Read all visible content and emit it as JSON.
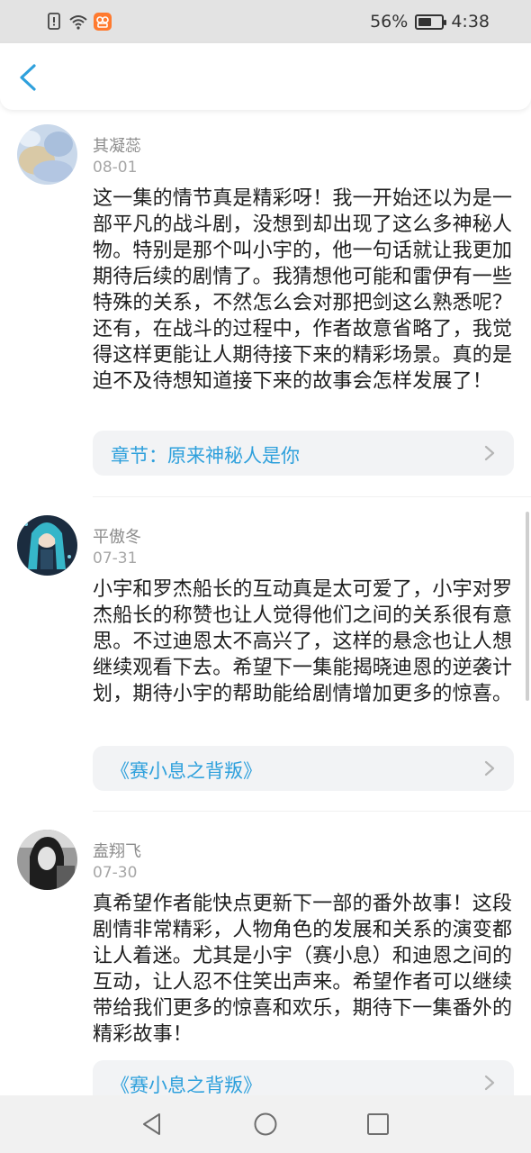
{
  "status_bar": {
    "battery_percent": "56%",
    "battery_level": 0.56,
    "time": "4:38",
    "icons": [
      "alert-icon",
      "wifi-icon",
      "app-notification-icon",
      "battery-charging-icon"
    ]
  },
  "header": {
    "back_icon": "chevron-left-icon",
    "accent_color": "#2ea0dc"
  },
  "comments": [
    {
      "author": "其凝蕊",
      "date": "08-01",
      "text": "这一集的情节真是精彩呀！我一开始还以为是一部平凡的战斗剧，没想到却出现了这么多神秘人物。特别是那个叫小宇的，他一句话就让我更加期待后续的剧情了。我猜想他可能和雷伊有一些特殊的关系，不然怎么会对那把剑这么熟悉呢？还有，在战斗的过程中，作者故意省略了，我觉得这样更能让人期待接下来的精彩场景。真的是迫不及待想知道接下来的故事会怎样发展了！",
      "chapter": "章节：原来神秘人是你"
    },
    {
      "author": "平傲冬",
      "date": "07-31",
      "text": "小宇和罗杰船长的互动真是太可爱了，小宇对罗杰船长的称赞也让人觉得他们之间的关系很有意思。不过迪恩太不高兴了，这样的悬念也让人想继续观看下去。希望下一集能揭晓迪恩的逆袭计划，期待小宇的帮助能给剧情增加更多的惊喜。",
      "chapter": "《赛小息之背叛》"
    },
    {
      "author": "盍翔飞",
      "date": "07-30",
      "text": "真希望作者能快点更新下一部的番外故事！这段剧情非常精彩，人物角色的发展和关系的演变都让人着迷。尤其是小宇（赛小息）和迪恩之间的互动，让人忍不住笑出声来。希望作者可以继续带给我们更多的惊喜和欢乐，期待下一集番外的精彩故事！",
      "chapter": "《赛小息之背叛》"
    }
  ],
  "nav_bar": {
    "icons": [
      "back-triangle-icon",
      "home-circle-icon",
      "recents-square-icon"
    ]
  }
}
